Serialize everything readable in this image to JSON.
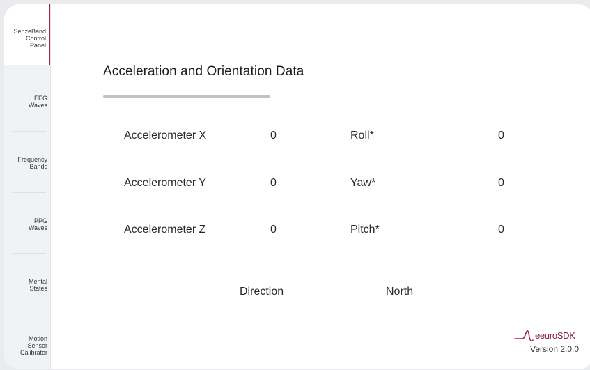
{
  "sidebar": {
    "items": [
      {
        "label": "SenzeBand\nControl\nPanel"
      },
      {
        "label": "EEG\nWaves"
      },
      {
        "label": "Frequency\nBands"
      },
      {
        "label": "PPG\nWaves"
      },
      {
        "label": "Mental\nStates"
      },
      {
        "label": "Motion\nSensor\nCalibrator"
      }
    ]
  },
  "main": {
    "title": "Acceleration and Orientation Data",
    "rows": [
      {
        "label": "Accelerometer X",
        "value": "0",
        "label2": "Roll*",
        "value2": "0"
      },
      {
        "label": "Accelerometer Y",
        "value": "0",
        "label2": "Yaw*",
        "value2": "0"
      },
      {
        "label": "Accelerometer Z",
        "value": "0",
        "label2": "Pitch*",
        "value2": "0"
      }
    ],
    "direction_label": "Direction",
    "direction_value": "North"
  },
  "brand": {
    "logo_text": "eeuroSDK",
    "version": "Version 2.0.0",
    "accent_color": "#a0234a",
    "logo_icon": "neuro-wave-icon"
  }
}
